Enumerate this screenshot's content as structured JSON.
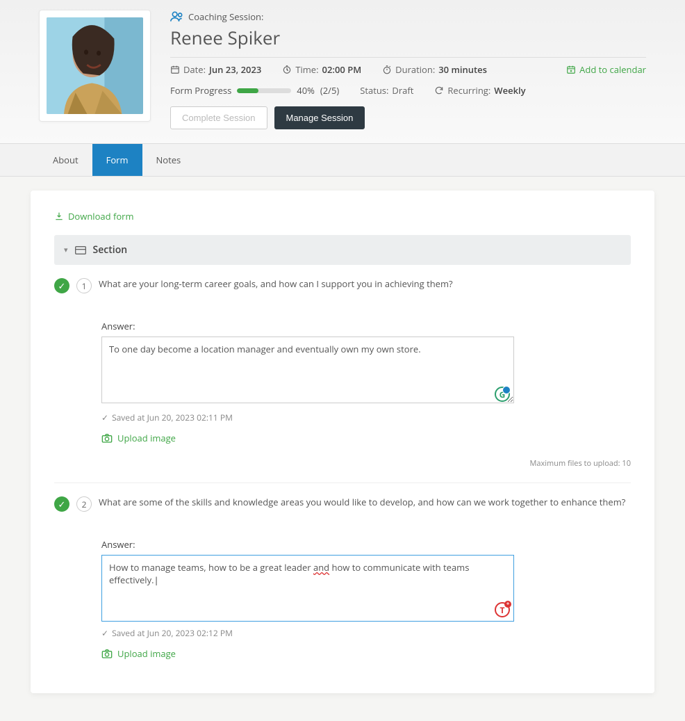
{
  "header": {
    "session_label": "Coaching Session:",
    "person_name": "Renee Spiker",
    "date_label": "Date:",
    "date_value": "Jun 23, 2023",
    "time_label": "Time:",
    "time_value": "02:00 PM",
    "duration_label": "Duration:",
    "duration_value": "30 minutes",
    "add_calendar": "Add to calendar",
    "progress_label": "Form Progress",
    "progress_percent": "40%",
    "progress_fraction": "(2/5)",
    "status_label": "Status:",
    "status_value": "Draft",
    "recurring_label": "Recurring:",
    "recurring_value": "Weekly",
    "complete_btn": "Complete Session",
    "manage_btn": "Manage Session"
  },
  "tabs": {
    "about": "About",
    "form": "Form",
    "notes": "Notes"
  },
  "form": {
    "download_link": "Download form",
    "section_title": "Section",
    "max_files_label": "Maximum files to upload:",
    "max_files_value": "10",
    "questions": [
      {
        "number": "1",
        "text": "What are your long-term career goals, and how can I support you in achieving them?",
        "answer_label": "Answer:",
        "answer_value": "To one day become a location manager and eventually own my own store.",
        "saved_text": "Saved at Jun 20, 2023 02:11 PM",
        "upload_label": "Upload image",
        "badge": "G"
      },
      {
        "number": "2",
        "text": "What are some of the skills and knowledge areas you would like to develop, and how can we work together to enhance them?",
        "answer_label": "Answer:",
        "answer_value_pre": "How to manage teams, how to be a great leader ",
        "answer_value_err": "and",
        "answer_value_post": " how to communicate with teams effectively.",
        "saved_text": "Saved at Jun 20, 2023 02:12 PM",
        "upload_label": "Upload image",
        "badge": "T"
      }
    ]
  }
}
